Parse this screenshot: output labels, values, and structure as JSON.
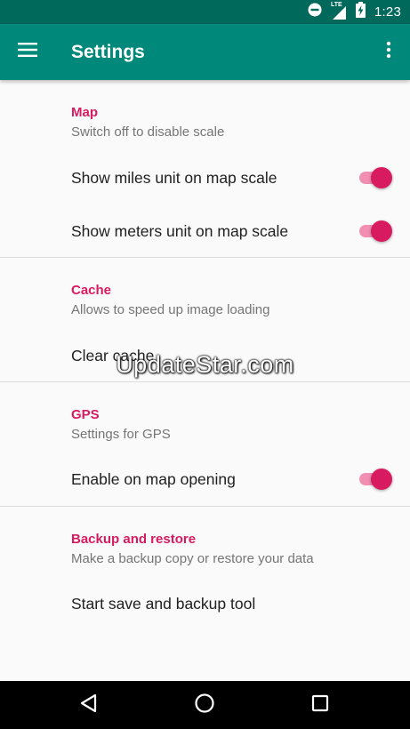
{
  "status_bar": {
    "time": "1:23",
    "network_label": "LTE",
    "icons": [
      "do-not-disturb-icon",
      "lte-signal-icon",
      "battery-charging-icon"
    ]
  },
  "app_bar": {
    "title": "Settings",
    "menu_icon": "hamburger-menu-icon",
    "overflow_icon": "more-vert-icon"
  },
  "colors": {
    "status_bar": "#00695c",
    "app_bar": "#00897b",
    "accent": "#d81b60",
    "switch_track": "#f18fb3"
  },
  "sections": {
    "map": {
      "title": "Map",
      "summary": "Switch off to disable scale",
      "items": [
        {
          "label": "Show miles unit on map scale",
          "checked": true
        },
        {
          "label": "Show meters unit on map scale",
          "checked": true
        }
      ]
    },
    "cache": {
      "title": "Cache",
      "summary": "Allows to speed up image loading",
      "items": [
        {
          "label": "Clear cache"
        }
      ]
    },
    "gps": {
      "title": "GPS",
      "summary": "Settings for GPS",
      "items": [
        {
          "label": "Enable on map opening",
          "checked": true
        }
      ]
    },
    "backup": {
      "title": "Backup and restore",
      "summary": "Make a backup copy or restore your data",
      "items": [
        {
          "label": "Start save and backup tool"
        }
      ]
    }
  },
  "watermark": "UpdateStar.com",
  "nav_bar": {
    "icons": [
      "back-icon",
      "home-icon",
      "recents-icon"
    ]
  }
}
